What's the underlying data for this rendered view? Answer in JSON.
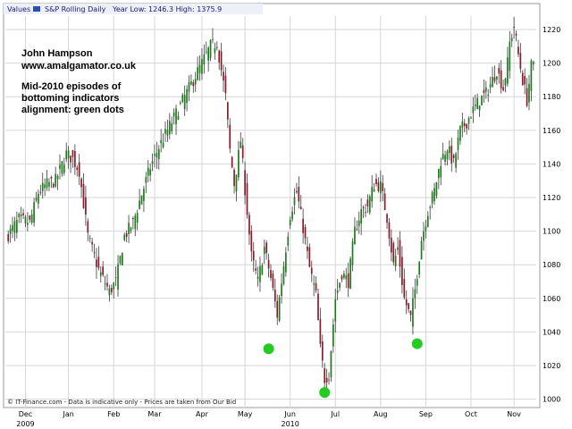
{
  "header": {
    "values_label": "Values",
    "legend_label": "S&P Rolling Daily",
    "stats": "Year Low: 1246.3 High: 1375.9"
  },
  "annotation": {
    "author": "John Hampson",
    "website": "www.amalgamator.co.uk",
    "note_line1": "Mid-2010 episodes of",
    "note_line2": "bottoming indicators",
    "note_line3": "alignment: green dots"
  },
  "footer": {
    "disclaimer": "© IT-Finance.com - Data is indicative only - Prices are taken from Our Bid"
  },
  "colors": {
    "up_candle": "#1e7a1e",
    "down_candle": "#8a1a2a",
    "wick": "#3a3a3a",
    "grid": "#d6d6d6",
    "dot": "#22cc22",
    "header_text": "#1a1a7a"
  },
  "chart_data": {
    "type": "candlestick",
    "title": "S&P Rolling Daily",
    "xlabel": "",
    "ylabel": "",
    "ylim": [
      995,
      1228
    ],
    "y_ticks": [
      1000,
      1020,
      1040,
      1060,
      1080,
      1100,
      1120,
      1140,
      1160,
      1180,
      1200,
      1220
    ],
    "x_ticks": [
      {
        "label": "Dec",
        "index": 8
      },
      {
        "label": "Jan",
        "index": 28
      },
      {
        "label": "Feb",
        "index": 49
      },
      {
        "label": "Mar",
        "index": 68
      },
      {
        "label": "Apr",
        "index": 90
      },
      {
        "label": "May",
        "index": 110
      },
      {
        "label": "Jun",
        "index": 131
      },
      {
        "label": "Jul",
        "index": 152
      },
      {
        "label": "Aug",
        "index": 173
      },
      {
        "label": "Sep",
        "index": 194
      },
      {
        "label": "Oct",
        "index": 215
      },
      {
        "label": "Nov",
        "index": 235
      }
    ],
    "year_labels": [
      {
        "label": "2009",
        "index": 8
      },
      {
        "label": "2010",
        "index": 131
      }
    ],
    "grid": true,
    "y_axis_side": "right",
    "close_anchors": [
      [
        0,
        1098
      ],
      [
        5,
        1107
      ],
      [
        10,
        1105
      ],
      [
        14,
        1123
      ],
      [
        18,
        1128
      ],
      [
        22,
        1130
      ],
      [
        27,
        1146
      ],
      [
        30,
        1143
      ],
      [
        33,
        1136
      ],
      [
        37,
        1097
      ],
      [
        42,
        1077
      ],
      [
        47,
        1064
      ],
      [
        50,
        1070
      ],
      [
        54,
        1097
      ],
      [
        58,
        1105
      ],
      [
        62,
        1122
      ],
      [
        66,
        1138
      ],
      [
        70,
        1150
      ],
      [
        74,
        1160
      ],
      [
        78,
        1170
      ],
      [
        82,
        1180
      ],
      [
        86,
        1190
      ],
      [
        90,
        1200
      ],
      [
        94,
        1210
      ],
      [
        97,
        1212
      ],
      [
        99,
        1196
      ],
      [
        101,
        1180
      ],
      [
        103,
        1148
      ],
      [
        105,
        1128
      ],
      [
        108,
        1154
      ],
      [
        110,
        1125
      ],
      [
        113,
        1085
      ],
      [
        116,
        1070
      ],
      [
        119,
        1090
      ],
      [
        122,
        1072
      ],
      [
        125,
        1050
      ],
      [
        128,
        1080
      ],
      [
        131,
        1110
      ],
      [
        134,
        1124
      ],
      [
        137,
        1102
      ],
      [
        140,
        1078
      ],
      [
        143,
        1062
      ],
      [
        145,
        1030
      ],
      [
        147,
        1012
      ],
      [
        149,
        1015
      ],
      [
        152,
        1060
      ],
      [
        155,
        1075
      ],
      [
        158,
        1070
      ],
      [
        161,
        1100
      ],
      [
        164,
        1112
      ],
      [
        167,
        1115
      ],
      [
        170,
        1128
      ],
      [
        173,
        1127
      ],
      [
        176,
        1108
      ],
      [
        179,
        1080
      ],
      [
        181,
        1090
      ],
      [
        184,
        1060
      ],
      [
        187,
        1048
      ],
      [
        189,
        1065
      ],
      [
        192,
        1095
      ],
      [
        195,
        1112
      ],
      [
        198,
        1124
      ],
      [
        201,
        1142
      ],
      [
        204,
        1150
      ],
      [
        207,
        1140
      ],
      [
        210,
        1160
      ],
      [
        213,
        1165
      ],
      [
        216,
        1172
      ],
      [
        219,
        1178
      ],
      [
        222,
        1182
      ],
      [
        225,
        1190
      ],
      [
        227,
        1196
      ],
      [
        230,
        1185
      ],
      [
        232,
        1200
      ],
      [
        233,
        1212
      ],
      [
        235,
        1222
      ],
      [
        237,
        1205
      ],
      [
        239,
        1190
      ],
      [
        241,
        1178
      ],
      [
        243,
        1198
      ]
    ],
    "bottoming_dots": [
      {
        "index": 121,
        "value": 1030
      },
      {
        "index": 147,
        "value": 1004
      },
      {
        "index": 190,
        "value": 1033
      }
    ]
  }
}
